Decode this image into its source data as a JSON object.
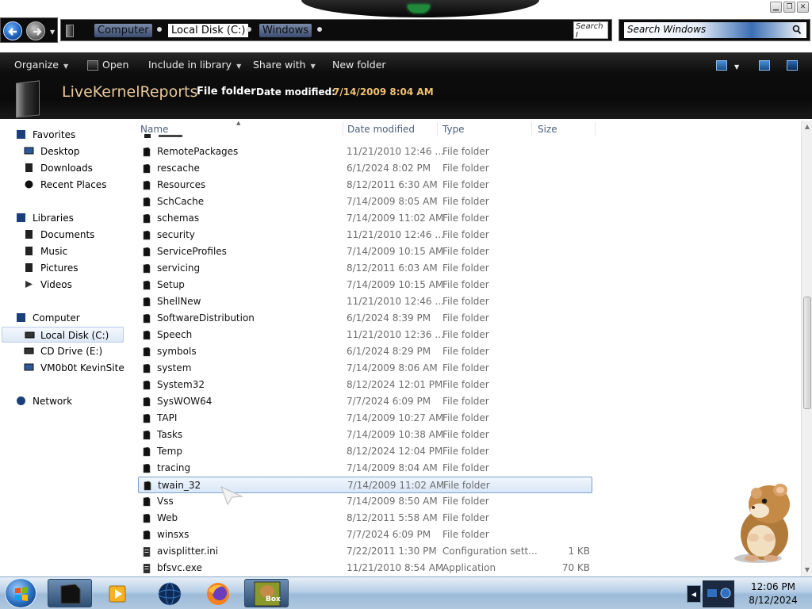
{
  "window": {
    "minimize_icon": "minimize-icon",
    "maximize_icon": "maximize-icon",
    "close_icon": "close-icon"
  },
  "address_bar": {
    "crumbs": [
      "Computer",
      "Local Disk (C:)",
      "Windows"
    ],
    "end_text": "Search I"
  },
  "search": {
    "placeholder": "Search Windows"
  },
  "toolbar": {
    "organize": "Organize",
    "open": "Open",
    "include_in_library": "Include in library",
    "share_with": "Share with",
    "new_folder": "New folder"
  },
  "details": {
    "name": "LiveKernelReports",
    "type": "File folder",
    "date_label": "Date modified:",
    "date_value": "7/14/2009 8:04 AM"
  },
  "nav": {
    "favorites": "Favorites",
    "desktop": "Desktop",
    "downloads": "Downloads",
    "recent_places": "Recent Places",
    "libraries": "Libraries",
    "documents": "Documents",
    "music": "Music",
    "pictures": "Pictures",
    "videos": "Videos",
    "computer": "Computer",
    "local_disk": "Local Disk (C:)",
    "cd_drive": "CD Drive (E:)",
    "vm_site": "VM0b0t KevinSite",
    "network": "Network"
  },
  "columns": {
    "name": "Name",
    "date_modified": "Date modified",
    "type": "Type",
    "size": "Size"
  },
  "files": [
    {
      "name": "RemotePackages",
      "date": "11/21/2010 12:46 ...",
      "type": "File folder",
      "size": ""
    },
    {
      "name": "rescache",
      "date": "6/1/2024 8:02 PM",
      "type": "File folder",
      "size": ""
    },
    {
      "name": "Resources",
      "date": "8/12/2011 6:30 AM",
      "type": "File folder",
      "size": ""
    },
    {
      "name": "SchCache",
      "date": "7/14/2009 8:05 AM",
      "type": "File folder",
      "size": ""
    },
    {
      "name": "schemas",
      "date": "7/14/2009 11:02 AM",
      "type": "File folder",
      "size": ""
    },
    {
      "name": "security",
      "date": "11/21/2010 12:46 ...",
      "type": "File folder",
      "size": ""
    },
    {
      "name": "ServiceProfiles",
      "date": "7/14/2009 10:15 AM",
      "type": "File folder",
      "size": ""
    },
    {
      "name": "servicing",
      "date": "8/12/2011 6:03 AM",
      "type": "File folder",
      "size": ""
    },
    {
      "name": "Setup",
      "date": "7/14/2009 10:15 AM",
      "type": "File folder",
      "size": ""
    },
    {
      "name": "ShellNew",
      "date": "11/21/2010 12:46 ...",
      "type": "File folder",
      "size": ""
    },
    {
      "name": "SoftwareDistribution",
      "date": "6/1/2024 8:39 PM",
      "type": "File folder",
      "size": ""
    },
    {
      "name": "Speech",
      "date": "11/21/2010 12:36 ...",
      "type": "File folder",
      "size": ""
    },
    {
      "name": "symbols",
      "date": "6/1/2024 8:29 PM",
      "type": "File folder",
      "size": ""
    },
    {
      "name": "system",
      "date": "7/14/2009 8:06 AM",
      "type": "File folder",
      "size": ""
    },
    {
      "name": "System32",
      "date": "8/12/2024 12:01 PM",
      "type": "File folder",
      "size": ""
    },
    {
      "name": "SysWOW64",
      "date": "7/7/2024 6:09 PM",
      "type": "File folder",
      "size": ""
    },
    {
      "name": "TAPI",
      "date": "7/14/2009 10:27 AM",
      "type": "File folder",
      "size": ""
    },
    {
      "name": "Tasks",
      "date": "7/14/2009 10:38 AM",
      "type": "File folder",
      "size": ""
    },
    {
      "name": "Temp",
      "date": "8/12/2024 12:04 PM",
      "type": "File folder",
      "size": ""
    },
    {
      "name": "tracing",
      "date": "7/14/2009 8:04 AM",
      "type": "File folder",
      "size": ""
    },
    {
      "name": "twain_32",
      "date": "7/14/2009 11:02 AM",
      "type": "File folder",
      "size": ""
    },
    {
      "name": "Vss",
      "date": "7/14/2009 8:50 AM",
      "type": "File folder",
      "size": ""
    },
    {
      "name": "Web",
      "date": "8/12/2011 5:58 AM",
      "type": "File folder",
      "size": ""
    },
    {
      "name": "winsxs",
      "date": "7/7/2024 6:09 PM",
      "type": "File folder",
      "size": ""
    },
    {
      "name": "avisplitter.ini",
      "date": "7/22/2011 1:30 PM",
      "type": "Configuration sett...",
      "size": "1 KB"
    },
    {
      "name": "bfsvc.exe",
      "date": "11/21/2010 8:54 AM",
      "type": "Application",
      "size": "70 KB"
    }
  ],
  "selected_file": "twain_32",
  "taskbar": {
    "time": "12:06 PM",
    "date": "8/12/2024",
    "box_label": "Box"
  }
}
